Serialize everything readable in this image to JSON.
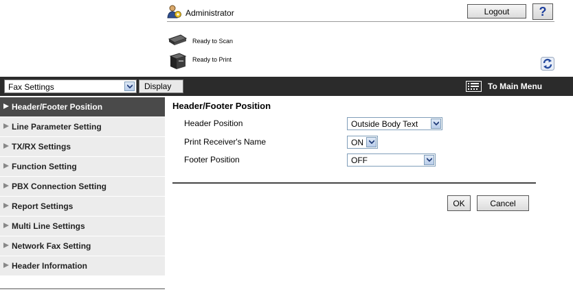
{
  "header": {
    "user_name": "Administrator",
    "logout_label": "Logout",
    "help_label": "?",
    "status": [
      {
        "icon": "scanner-icon",
        "text": "Ready to Scan"
      },
      {
        "icon": "printer-icon",
        "text": "Ready to Print"
      }
    ]
  },
  "toolbar": {
    "function_select_value": "Fax Settings",
    "display_label": "Display",
    "main_menu_label": "To Main Menu"
  },
  "sidebar": {
    "items": [
      {
        "label": "Header/Footer Position",
        "active": true
      },
      {
        "label": "Line Parameter Setting",
        "active": false
      },
      {
        "label": "TX/RX Settings",
        "active": false
      },
      {
        "label": "Function Setting",
        "active": false
      },
      {
        "label": "PBX Connection Setting",
        "active": false
      },
      {
        "label": "Report Settings",
        "active": false
      },
      {
        "label": "Multi Line Settings",
        "active": false
      },
      {
        "label": "Network Fax Setting",
        "active": false
      },
      {
        "label": "Header Information",
        "active": false
      }
    ]
  },
  "main": {
    "title": "Header/Footer Position",
    "fields": [
      {
        "label": "Header Position",
        "value": "Outside Body Text"
      },
      {
        "label": "Print Receiver's Name",
        "value": "ON"
      },
      {
        "label": "Footer Position",
        "value": "OFF"
      }
    ],
    "ok_label": "OK",
    "cancel_label": "Cancel"
  },
  "colors": {
    "topbar": "#2b2b2b",
    "active_nav": "#4a4a4a",
    "nav_bg": "#ececec",
    "help_blue": "#1c3e9c"
  }
}
